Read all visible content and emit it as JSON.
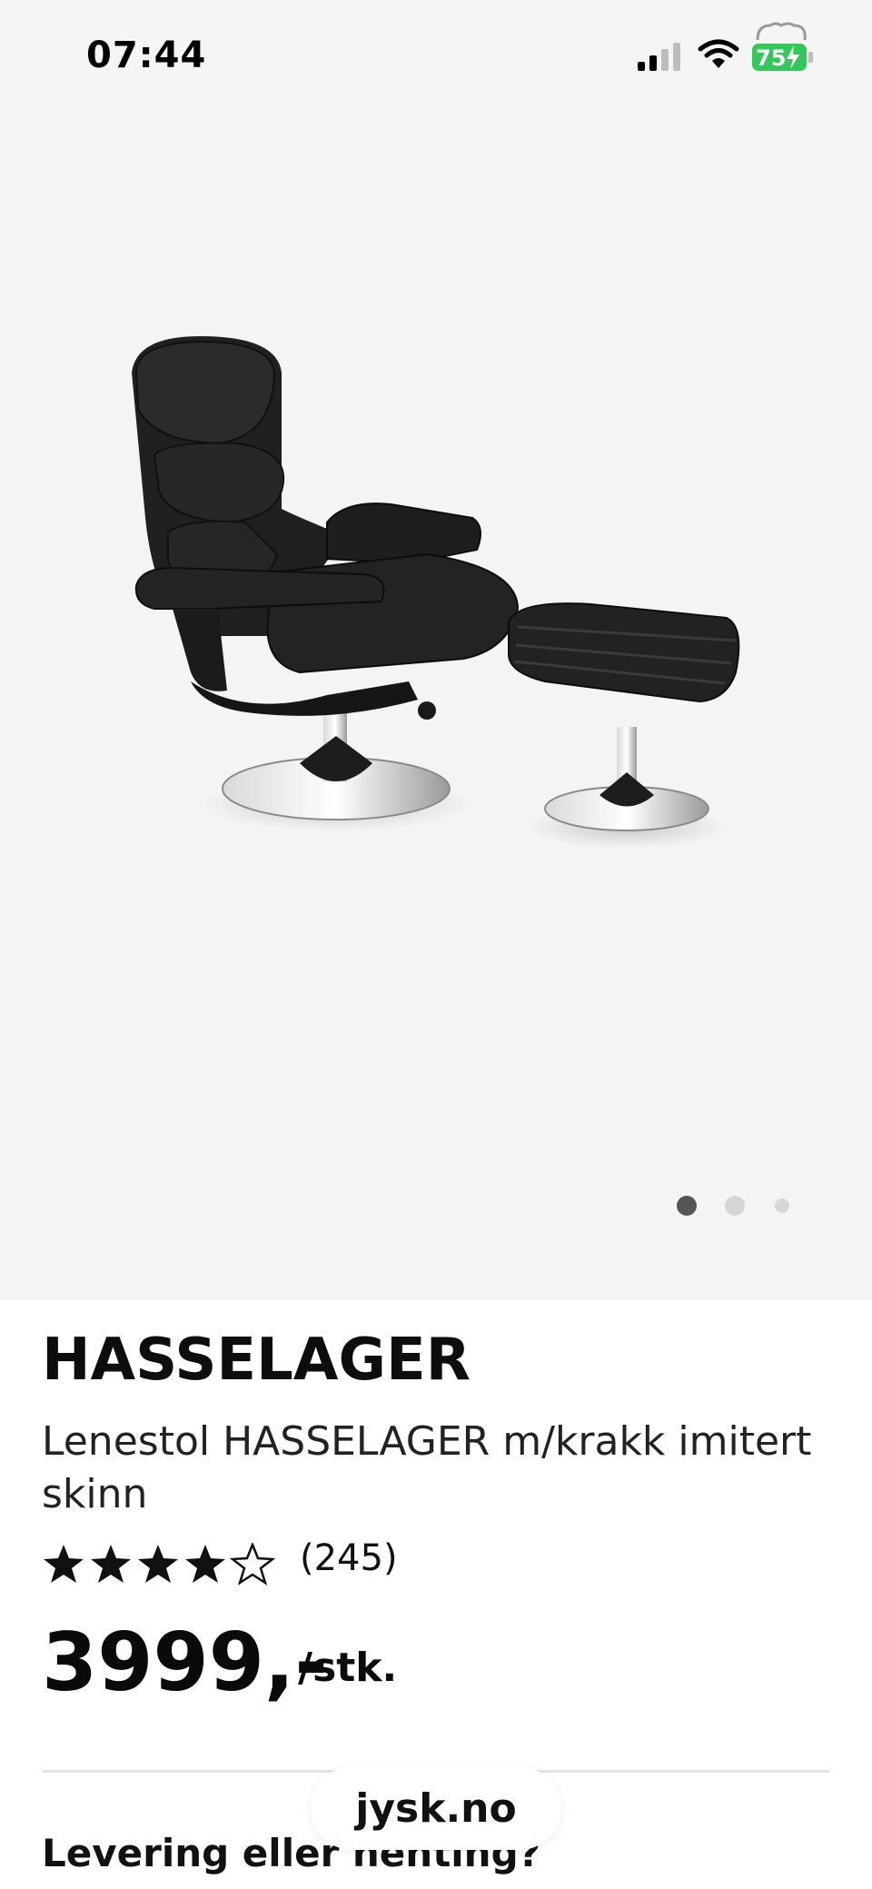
{
  "status_bar": {
    "time": "07:44",
    "battery_percent": "75",
    "signal_bars": 2,
    "icons": [
      "signal-icon",
      "wifi-icon",
      "battery-charging-icon"
    ]
  },
  "gallery": {
    "image_count": 3,
    "active_index": 0
  },
  "product": {
    "brand": "HASSELAGER",
    "name": "Lenestol HASSELAGER m/krakk imitert skinn",
    "rating": 4,
    "rating_max": 5,
    "review_count": "(245)",
    "price": "3999,-",
    "unit": "/stk."
  },
  "delivery": {
    "heading": "Levering eller henting?"
  },
  "browser": {
    "url": "jysk.no"
  },
  "colors": {
    "battery_green": "#34c759",
    "hero_bg": "#f4f4f4",
    "dot_active": "#555555",
    "dot_inactive": "#d6d6d6"
  }
}
